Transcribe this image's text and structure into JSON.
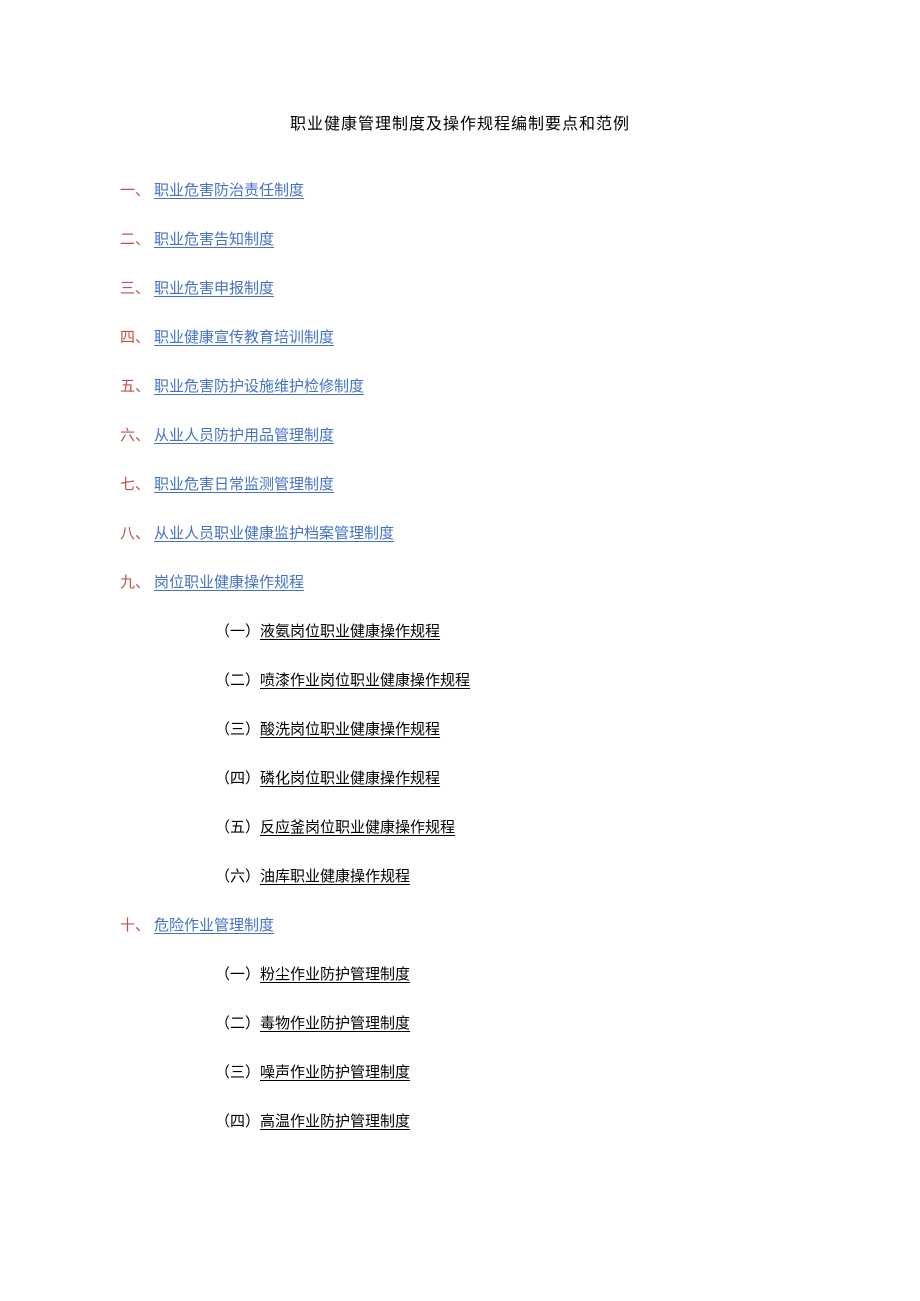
{
  "title": "职业健康管理制度及操作规程编制要点和范例",
  "items": [
    {
      "num": "一、",
      "label": "职业危害防治责任制度"
    },
    {
      "num": "二、",
      "label": "职业危害告知制度"
    },
    {
      "num": "三、",
      "label": "职业危害申报制度"
    },
    {
      "num": "四、",
      "label": "职业健康宣传教育培训制度"
    },
    {
      "num": "五、",
      "label": "职业危害防护设施维护检修制度"
    },
    {
      "num": "六、",
      "label": "从业人员防护用品管理制度"
    },
    {
      "num": "七、",
      "label": "职业危害日常监测管理制度"
    },
    {
      "num": "八、",
      "label": "从业人员职业健康监护档案管理制度"
    },
    {
      "num": "九、",
      "label": "岗位职业健康操作规程"
    }
  ],
  "subitems9": [
    {
      "num": "（一）",
      "label": "液氨岗位职业健康操作规程"
    },
    {
      "num": "（二）",
      "label": "喷漆作业岗位职业健康操作规程"
    },
    {
      "num": "（三）",
      "label": "酸洗岗位职业健康操作规程"
    },
    {
      "num": "（四）",
      "label": "磷化岗位职业健康操作规程"
    },
    {
      "num": "（五）",
      "label": "反应釜岗位职业健康操作规程"
    },
    {
      "num": "（六）",
      "label": "油库职业健康操作规程"
    }
  ],
  "item10": {
    "num": "十、",
    "label": "危险作业管理制度"
  },
  "subitems10": [
    {
      "num": "（一）",
      "label": "粉尘作业防护管理制度"
    },
    {
      "num": "（二）",
      "label": "毒物作业防护管理制度"
    },
    {
      "num": "（三）",
      "label": "噪声作业防护管理制度"
    },
    {
      "num": "（四）",
      "label": "高温作业防护管理制度"
    }
  ]
}
